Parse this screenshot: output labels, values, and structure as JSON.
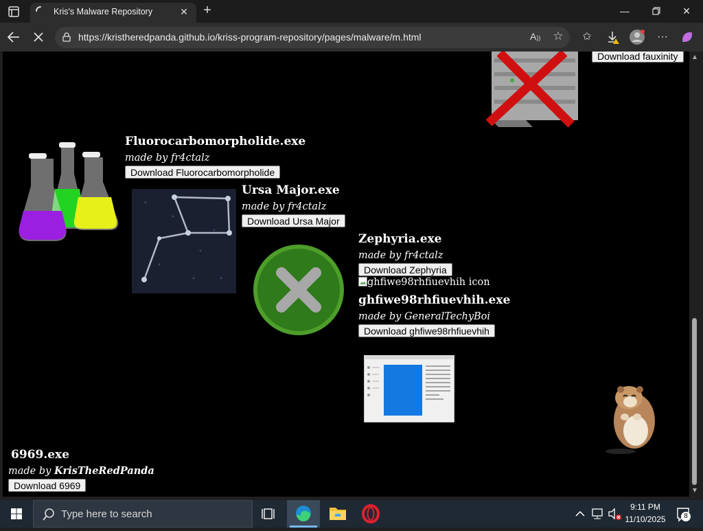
{
  "browser": {
    "tab_title": "Kris's Malware Repository",
    "url": "https://kristheredpanda.github.io/kriss-program-repository/pages/malware/m.html",
    "read_aloud_label": "A"
  },
  "page": {
    "entries": [
      {
        "id": "fauxinity",
        "button": "Download fauxinity"
      },
      {
        "id": "fluorocarbo",
        "title": "Fluorocarbomorpholide.exe",
        "author_prefix": "made by",
        "author": "fr4ctalz",
        "button": "Download Fluorocarbomorpholide"
      },
      {
        "id": "ursa",
        "title": "Ursa Major.exe",
        "author_prefix": "made by",
        "author": "fr4ctalz",
        "button": "Download Ursa Major"
      },
      {
        "id": "zephyria",
        "title": "Zephyria.exe",
        "author_prefix": "made by",
        "author": "fr4ctalz",
        "button": "Download Zephyria"
      },
      {
        "id": "ghfiwe",
        "broken_icon_alt": "ghfiwe98rhfiuevhih icon",
        "title": "ghfiwe98rhfiuevhih.exe",
        "author_prefix": "made by",
        "author": "GeneralTechyBoi",
        "button": "Download ghfiwe98rhfiuevhih"
      },
      {
        "id": "sixnine",
        "title": "6969.exe",
        "author_prefix": "made by",
        "author": "KrisTheRedPanda",
        "button": "Download 6969"
      }
    ]
  },
  "taskbar": {
    "search_placeholder": "Type here to search",
    "time": "9:11 PM",
    "date": "11/10/2025",
    "notification_count": "8"
  },
  "colors": {
    "page_bg": "#000000",
    "browser_chrome": "#2d2d2d",
    "taskbar": "#1f2933",
    "accent": "#0078d4"
  }
}
